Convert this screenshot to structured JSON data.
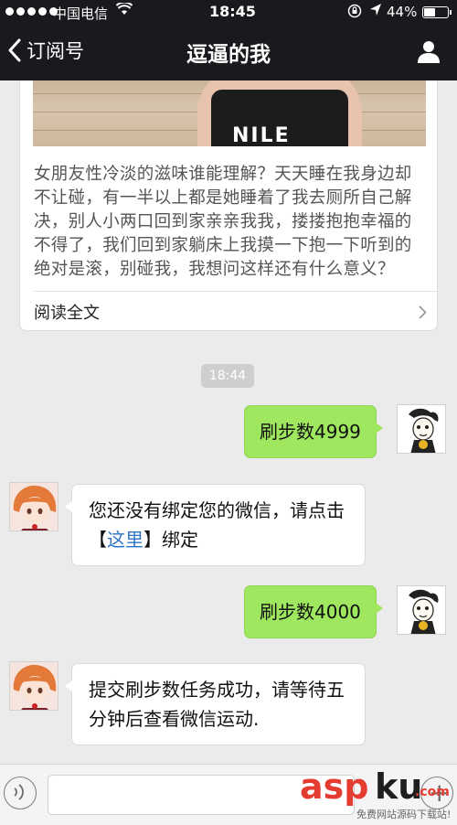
{
  "status_bar": {
    "carrier": "中国电信",
    "time": "18:45",
    "battery": "44%",
    "battery_level": 0.44
  },
  "nav": {
    "back_label": "订阅号",
    "title": "逗逼的我"
  },
  "article": {
    "image_text": "NILE",
    "summary": "女朋友性冷淡的滋味谁能理解？天天睡在我身边却不让碰，有一半以上都是她睡着了我去厕所自己解决，别人小两口回到家亲亲我我，搂搂抱抱幸福的不得了，我们回到家躺床上我摸一下抱一下听到的绝对是滚，别碰我，我想问这样还有什么意义？",
    "read_all": "阅读全文"
  },
  "timestamp": "18:44",
  "messages": [
    {
      "from": "me",
      "text": "刷步数4999"
    },
    {
      "from": "bot",
      "text_before": "您还没有绑定您的微信，请点击【",
      "link": "这里",
      "text_after": "】绑定"
    },
    {
      "from": "me",
      "text": "刷步数4000"
    },
    {
      "from": "bot",
      "text": "提交刷步数任务成功，请等待五分钟后查看微信运动."
    }
  ],
  "watermark": {
    "brand_a": "asp",
    "brand_b": "ku",
    "brand_c": ".com",
    "tagline": "免费网站源码下载站!"
  },
  "colors": {
    "my_bubble": "#9fe75e",
    "link": "#2d74c4",
    "header": "#1a1a1e",
    "background": "#ebebeb"
  }
}
